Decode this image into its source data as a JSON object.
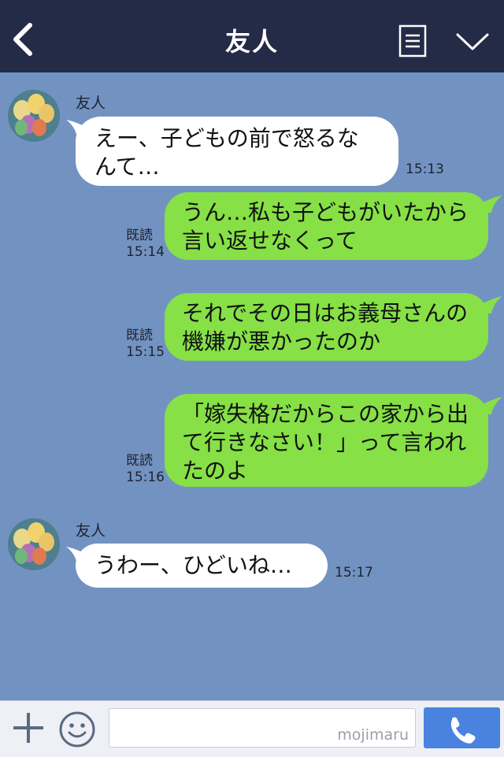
{
  "header": {
    "title": "友人"
  },
  "messages": [
    {
      "type": "in",
      "sender": "友人",
      "text": "えー、子どもの前で怒るなんて…",
      "time": "15:13"
    },
    {
      "type": "out",
      "read": "既読",
      "text": "うん…私も子どもがいたから言い返せなくって",
      "time": "15:14"
    },
    {
      "type": "out",
      "read": "既読",
      "text": "それでその日はお義母さんの機嫌が悪かったのか",
      "time": "15:15"
    },
    {
      "type": "out",
      "read": "既読",
      "text": "「嫁失格だからこの家から出て行きなさい！」って言われたのよ",
      "time": "15:16"
    },
    {
      "type": "in",
      "sender": "友人",
      "text": "うわー、ひどいね…",
      "time": "15:17"
    }
  ],
  "input": {
    "placeholder": "",
    "watermark": "mojimaru"
  },
  "icons": {
    "back": "back-icon",
    "menu": "menu-icon",
    "collapse": "chevron-down-icon",
    "add": "plus-icon",
    "emoji": "emoji-icon",
    "call": "phone-icon"
  },
  "colors": {
    "header": "#232b46",
    "background": "#7293c2",
    "incoming": "#ffffff",
    "outgoing": "#86e046",
    "call_button": "#4a82e0"
  }
}
